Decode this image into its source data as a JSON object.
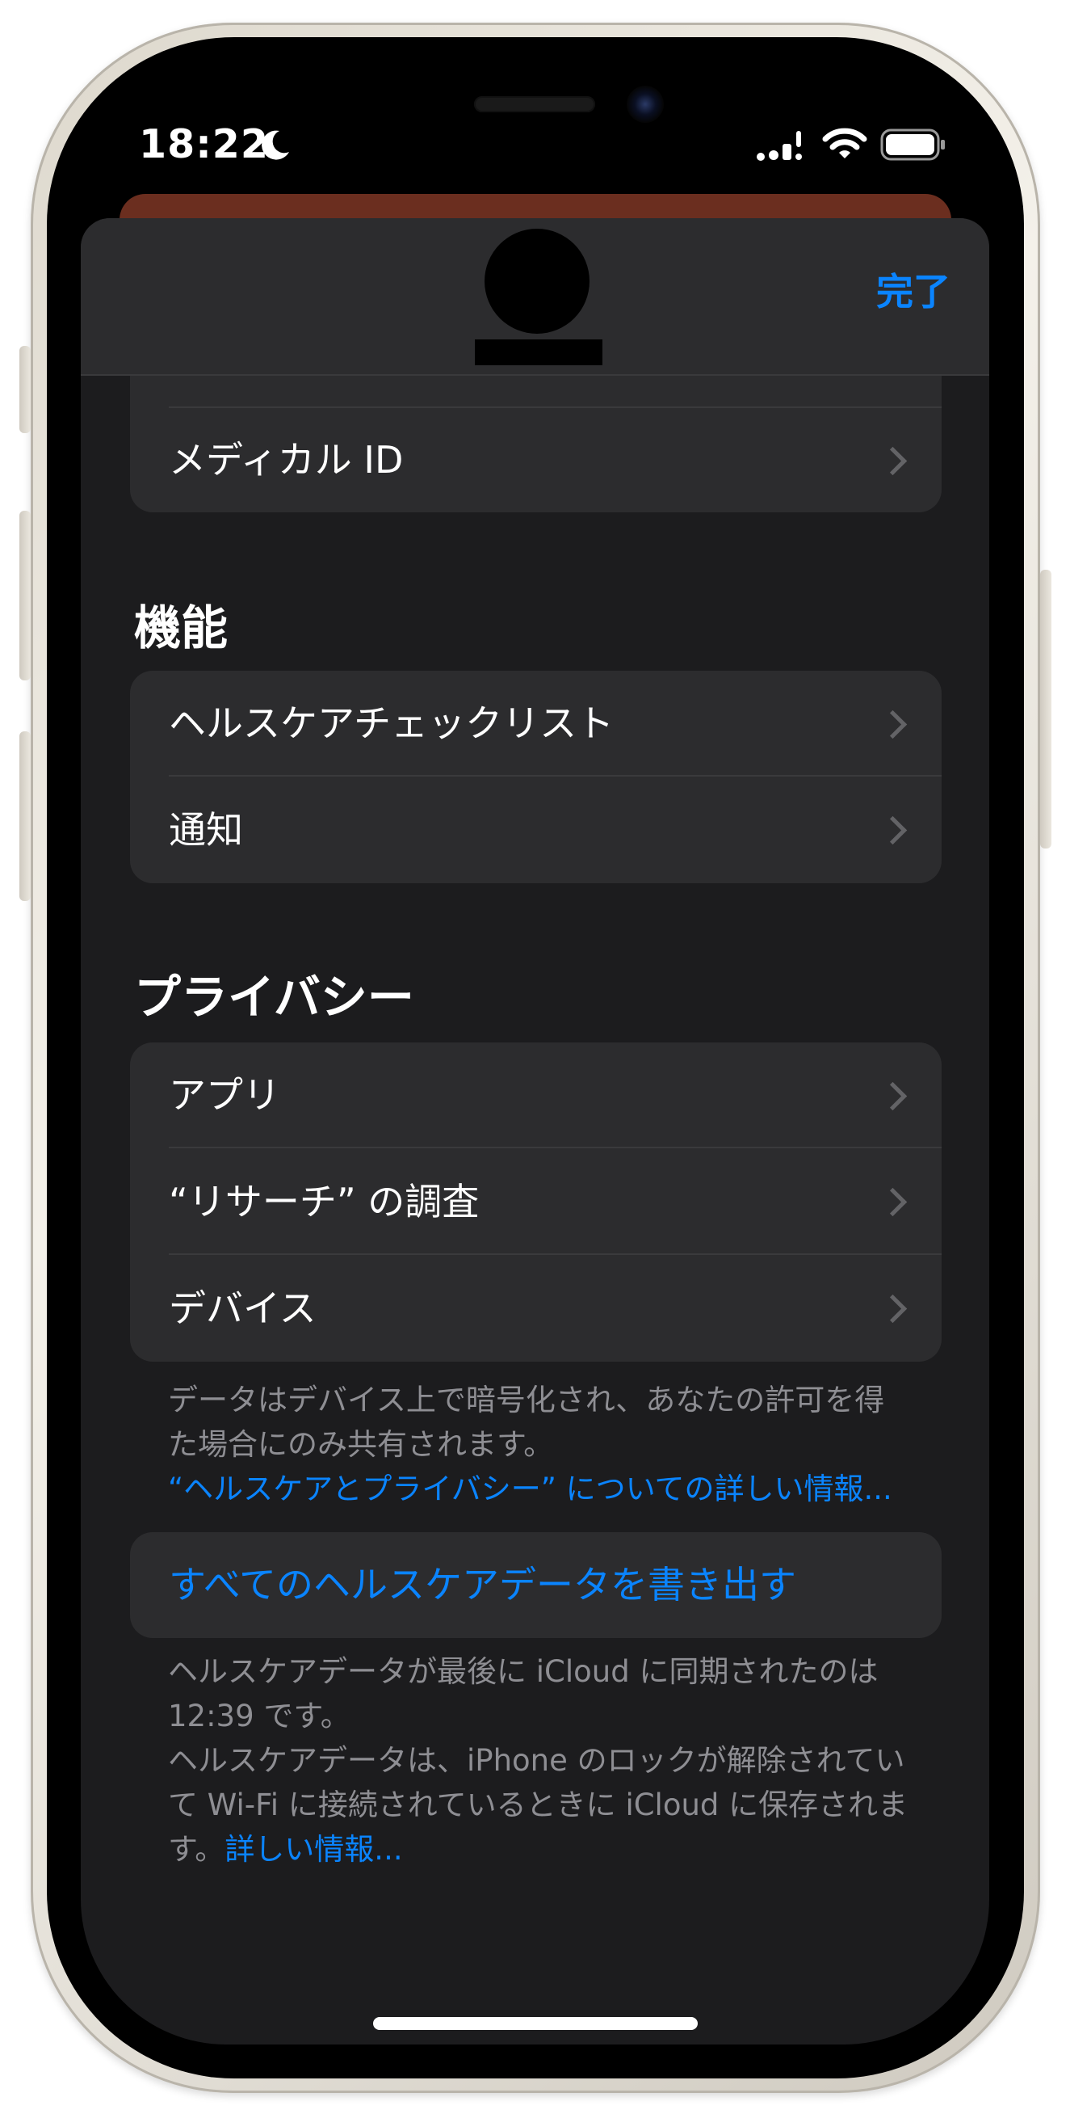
{
  "status_bar": {
    "time": "18:22",
    "moon_icon": "moon-icon",
    "signal_icon": "cellular-signal-icon",
    "wifi_icon": "wifi-icon",
    "battery_icon": "battery-icon"
  },
  "header": {
    "done_label": "完了"
  },
  "profile_group": {
    "medical_id_label": "メディカル ID"
  },
  "features": {
    "title": "機能",
    "items": [
      {
        "label": "ヘルスケアチェックリスト"
      },
      {
        "label": "通知"
      }
    ]
  },
  "privacy": {
    "title": "プライバシー",
    "items": [
      {
        "label": "アプリ"
      },
      {
        "label": "“リサーチ” の調査"
      },
      {
        "label": "デバイス"
      }
    ],
    "footer_line1": "データはデバイス上で暗号化され、あなたの許可を得",
    "footer_line2": "た場合にのみ共有されます。",
    "footer_link": "“ヘルスケアとプライバシー” についての詳しい情報..."
  },
  "export": {
    "label": "すべてのヘルスケアデータを書き出す",
    "footer_line1": "ヘルスケアデータが最後に iCloud に同期されたのは",
    "footer_line2": "12:39 です。",
    "footer_line3": "ヘルスケアデータは、iPhone のロックが解除されてい",
    "footer_line4": "て Wi-Fi に接続されているときに iCloud に保存されま",
    "footer_line5_prefix": "す。",
    "footer_link": "詳しい情報..."
  },
  "colors": {
    "accent": "#0a84ff",
    "sheet_background": "#1c1c1e",
    "group_background": "#2c2c2e"
  }
}
